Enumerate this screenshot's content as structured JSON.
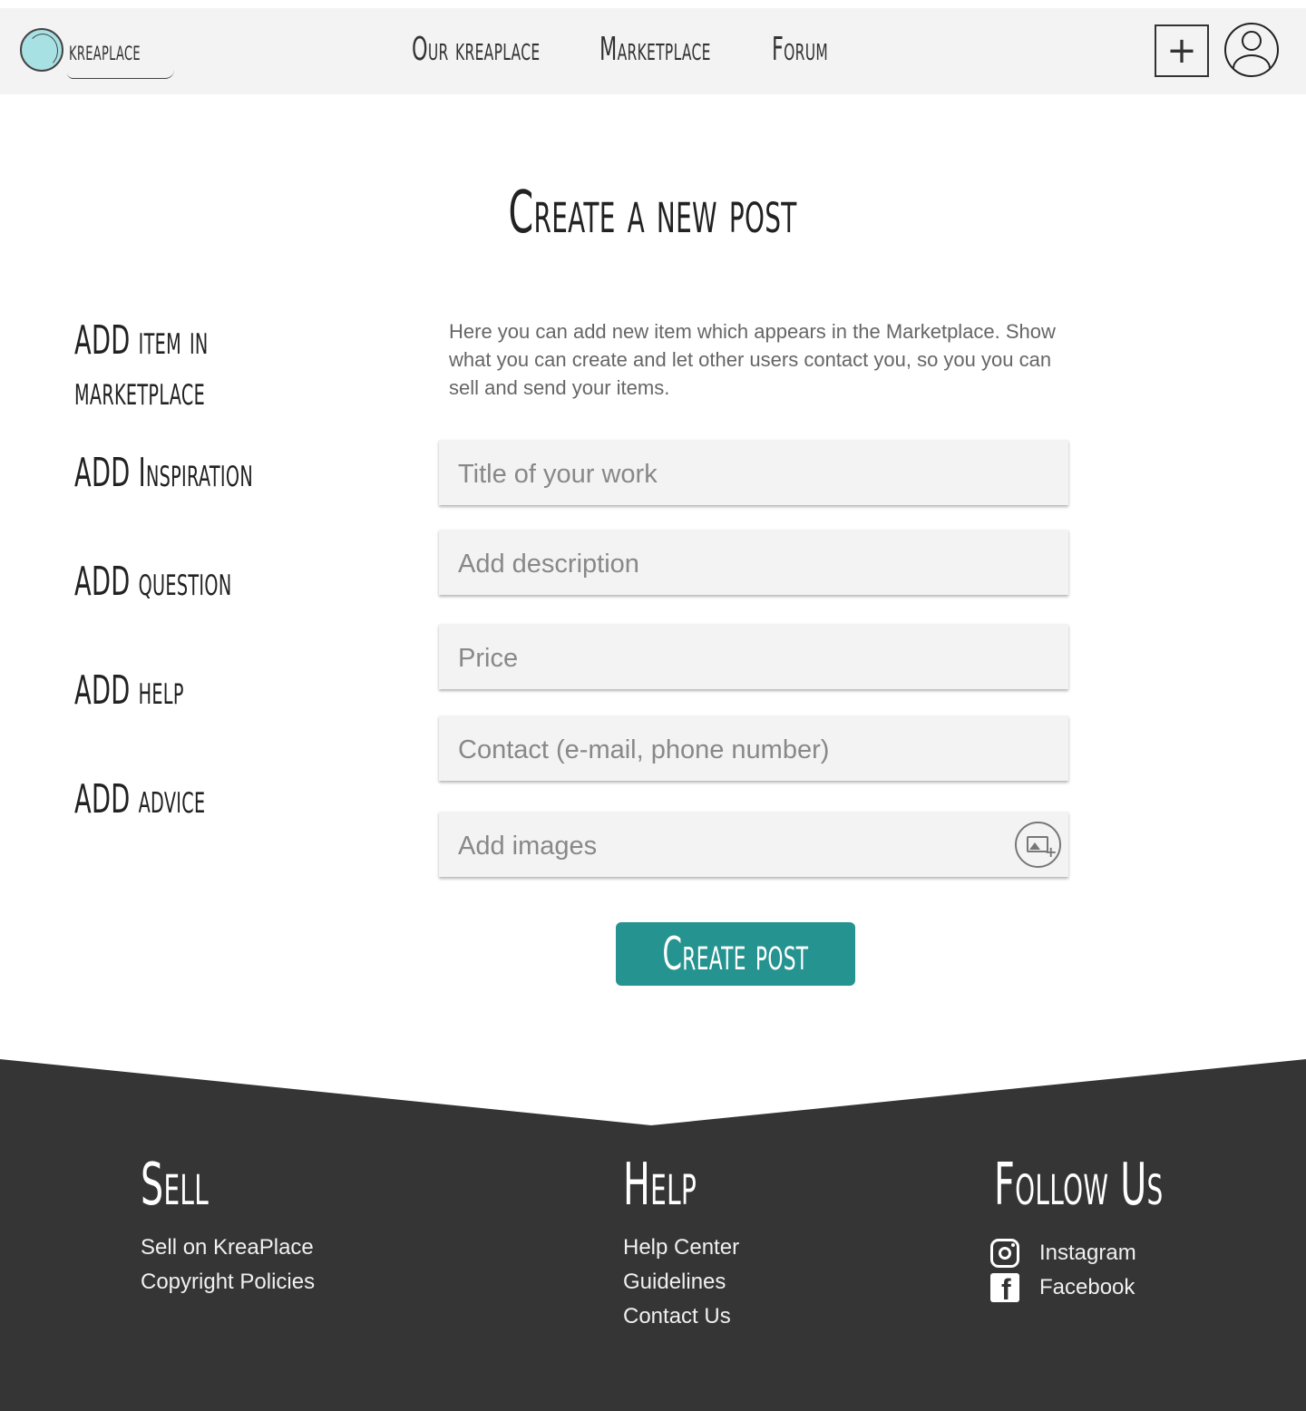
{
  "header": {
    "logo_text": "kreaplace",
    "nav": [
      "Our kreaplace",
      "Marketplace",
      "Forum"
    ],
    "add_icon": "plus-square-icon",
    "avatar_icon": "user-icon"
  },
  "page": {
    "title": "Create a new post"
  },
  "sidebar": {
    "items": [
      "ADD item in",
      "marketplace",
      "ADD Inspiration",
      "ADD question",
      "ADD help",
      "ADD advice"
    ]
  },
  "form": {
    "intro": "Here you can add new item which appears in the Marketplace. Show what you can create and let other users contact you, so you you can sell and send your items.",
    "fields": [
      "Title of your work",
      "Add description",
      "Price",
      "Contact (e-mail, phone number)",
      "Add images"
    ],
    "image_icon": "add-image-icon",
    "submit_label": "Create post"
  },
  "footer": {
    "sell": {
      "title": "Sell",
      "links": [
        "Sell on KreaPlace",
        "Copyright Policies"
      ]
    },
    "help": {
      "title": "Help",
      "links": [
        "Help Center",
        "Guidelines",
        "Contact Us"
      ]
    },
    "follow": {
      "title": "Follow Us",
      "links": [
        "Instagram",
        "Facebook"
      ]
    }
  },
  "colors": {
    "header_bg": "#f3f3f3",
    "accent": "#259390",
    "footer_bg": "#353535",
    "logo_ball": "#a8e1e4"
  }
}
